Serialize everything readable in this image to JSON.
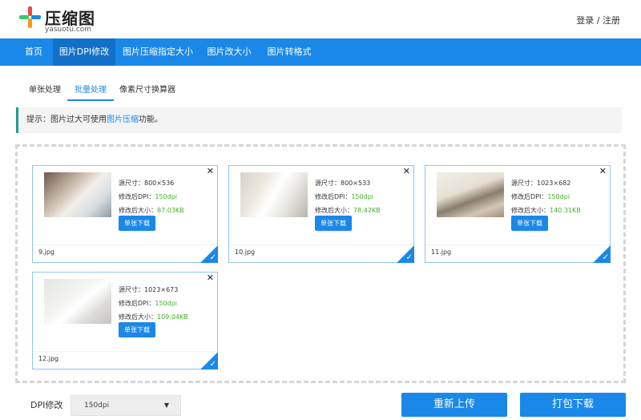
{
  "header": {
    "logo_title": "压缩图",
    "logo_sub": "yasuotu.com",
    "login": "登录",
    "sep": " / ",
    "register": "注册"
  },
  "nav": {
    "items": [
      "首页",
      "图片DPI修改",
      "图片压缩指定大小",
      "图片改大小",
      "图片转格式"
    ],
    "active": "图片DPI修改"
  },
  "subtabs": {
    "items": [
      "单张处理",
      "批量处理",
      "像素尺寸换算器"
    ],
    "active": "批量处理"
  },
  "tip": {
    "prefix": "提示：图片过大可使用",
    "link": "图片压缩",
    "suffix": "功能。"
  },
  "cards": [
    {
      "orig_label": "源尺寸：",
      "orig": "800×536",
      "dpi_label": "修改后DPI：",
      "dpi": "150dpi",
      "size_label": "修改后大小：",
      "size": "87.03KB",
      "button": "单张下载",
      "filename": "9.jpg"
    },
    {
      "orig_label": "源尺寸：",
      "orig": "800×533",
      "dpi_label": "修改后DPI：",
      "dpi": "150dpi",
      "size_label": "修改后大小：",
      "size": "78.42KB",
      "button": "单张下载",
      "filename": "10.jpg"
    },
    {
      "orig_label": "源尺寸：",
      "orig": "1023×682",
      "dpi_label": "修改后DPI：",
      "dpi": "150dpi",
      "size_label": "修改后大小：",
      "size": "140.31KB",
      "button": "单张下载",
      "filename": "11.jpg"
    },
    {
      "orig_label": "源尺寸：",
      "orig": "1023×673",
      "dpi_label": "修改后DPI：",
      "dpi": "150dpi",
      "size_label": "修改后大小：",
      "size": "109.04KB",
      "button": "单张下载",
      "filename": "12.jpg"
    }
  ],
  "icons": {
    "close": "close-icon",
    "check": "check-icon",
    "caret": "caret-down-icon"
  },
  "bottom": {
    "dpi_label": "DPI修改",
    "dpi_value": "150dpi",
    "reupload": "重新上传",
    "pack_download": "打包下载"
  },
  "colors": {
    "accent": "#1a88e8",
    "nav_active": "#1270c8",
    "value_green": "#43b02a",
    "tip_bar": "#1aa08a"
  }
}
